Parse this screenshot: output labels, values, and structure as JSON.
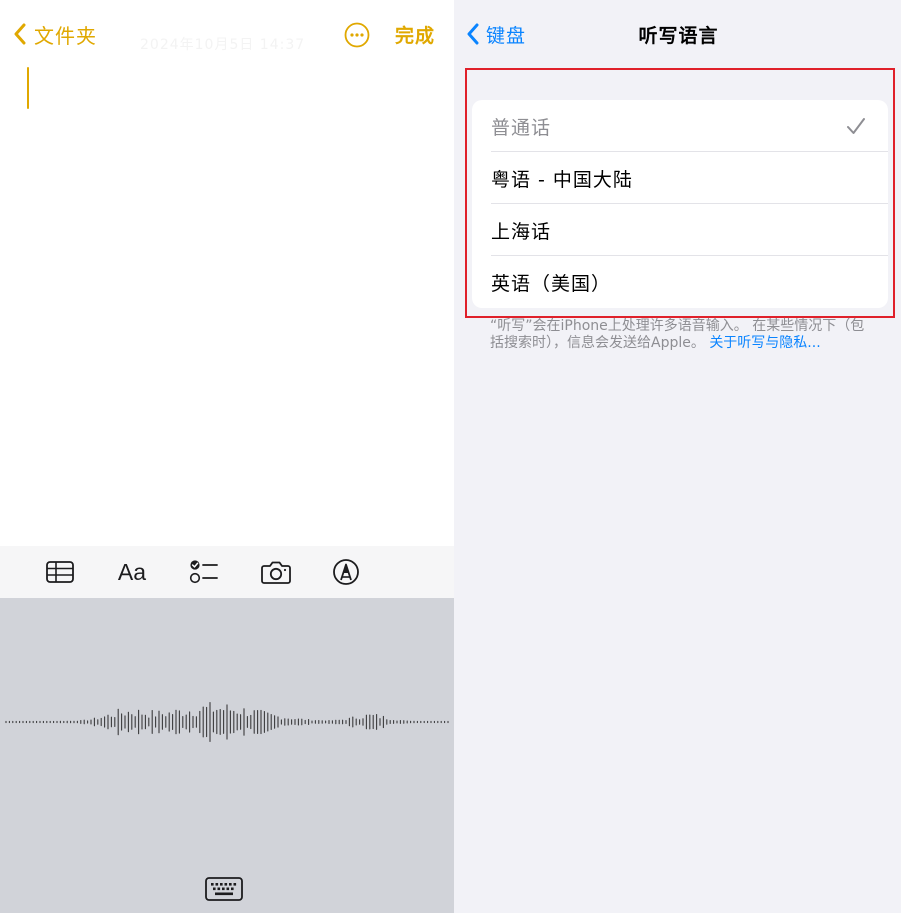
{
  "notes": {
    "back_label": "文件夹",
    "date_text": "2024年10月5日 14:37",
    "done_label": "完成",
    "accent_color": "#E0A800",
    "format_bar": {
      "icons": [
        "table-icon",
        "text-format-icon",
        "checklist-icon",
        "camera-icon",
        "markup-icon"
      ],
      "text_format_label": "Aa"
    },
    "dictation": {
      "background": "#D1D3D9",
      "icons": [
        "waveform-icon",
        "keyboard-icon"
      ]
    }
  },
  "settings": {
    "back_label": "键盘",
    "title": "听写语言",
    "accent_color": "#0A84FF",
    "languages": [
      {
        "label": "普通话",
        "selected": true
      },
      {
        "label": "粤语 - 中国大陆",
        "selected": false
      },
      {
        "label": "上海话",
        "selected": false
      },
      {
        "label": "英语（美国）",
        "selected": false
      }
    ],
    "footnote_text": "“听写”会在iPhone上处理许多语音输入。 在某些情况下（包括搜索时），信息会发送给Apple。 ",
    "footnote_link": "关于听写与隐私...",
    "highlight_color": "#E0202A"
  }
}
